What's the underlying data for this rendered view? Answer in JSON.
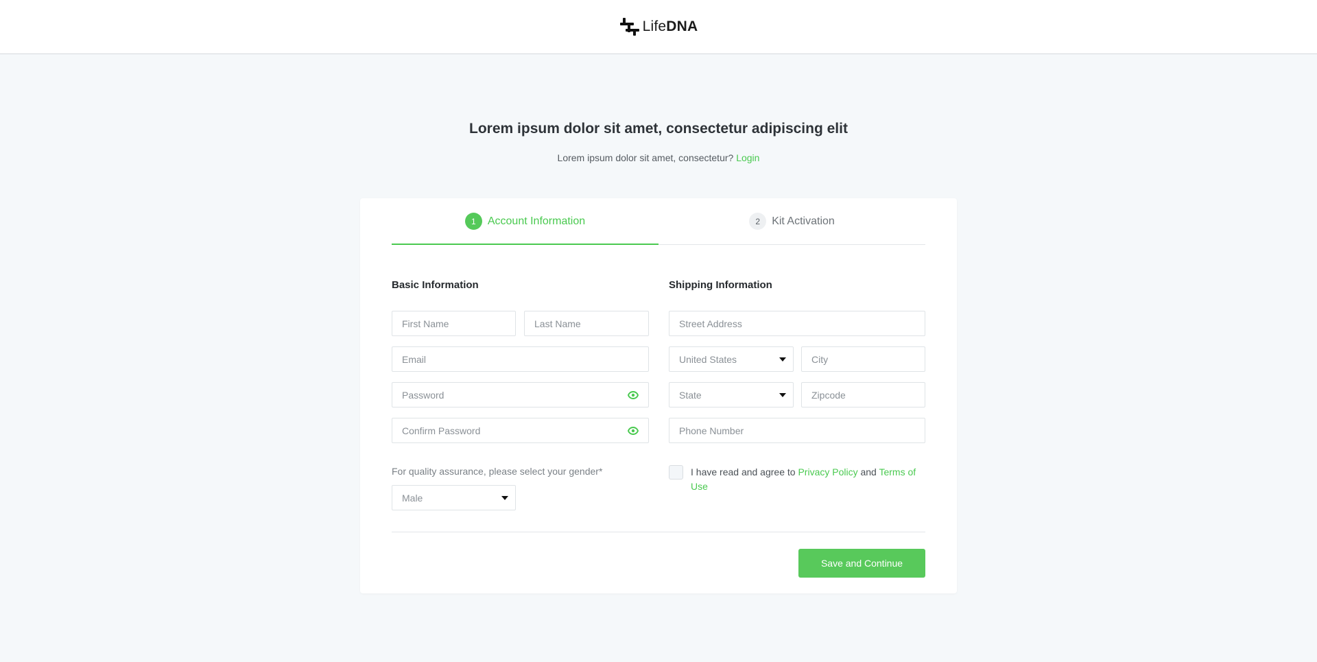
{
  "brand": {
    "name_light": "Life",
    "name_bold": "DNA"
  },
  "hero": {
    "title": "Lorem ipsum dolor sit amet, consectetur adipiscing elit",
    "subtitle": "Lorem ipsum dolor sit amet, consectetur?",
    "login_link": "Login"
  },
  "steps": [
    {
      "number": "1",
      "label": "Account Information",
      "active": true
    },
    {
      "number": "2",
      "label": "Kit Activation",
      "active": false
    }
  ],
  "basic": {
    "title": "Basic Information",
    "first_name_placeholder": "First Name",
    "last_name_placeholder": "Last Name",
    "email_placeholder": "Email",
    "password_placeholder": "Password",
    "confirm_password_placeholder": "Confirm Password",
    "gender_label": "For quality assurance, please select your gender*",
    "gender_value": "Male"
  },
  "shipping": {
    "title": "Shipping Information",
    "street_placeholder": "Street Address",
    "country_value": "United States",
    "city_placeholder": "City",
    "state_value": "State",
    "zipcode_placeholder": "Zipcode",
    "phone_placeholder": "Phone Number"
  },
  "agreement": {
    "text_prefix": "I have read and agree to",
    "privacy_link": "Privacy Policy",
    "and": "and",
    "terms_link": "Terms of Use"
  },
  "actions": {
    "save_label": "Save and Continue"
  },
  "colors": {
    "accent": "#49c94f",
    "button": "#58c95b",
    "background": "#f5f8fa"
  },
  "icons": {
    "password_toggle": "eye-icon",
    "dropdown": "caret-down-icon"
  }
}
